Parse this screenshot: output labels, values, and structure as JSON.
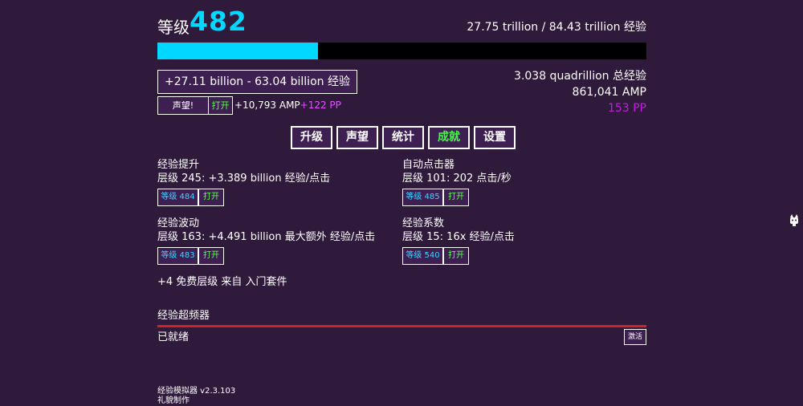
{
  "header": {
    "level_label": "等级",
    "level_value": "482",
    "xp_progress": "27.75 trillion / 84.43 trillion 经验",
    "xp_fraction": 0.3287
  },
  "click_range": "+27.11 billion - 63.04 billion 经验",
  "prestige": {
    "button_label": "声望!",
    "open_label": "打开",
    "amp_gain": "+10,793 AMP",
    "pp_gain": "+122 PP"
  },
  "stats": {
    "total_xp": "3.038 quadrillion 总经验",
    "amp": "861,041 AMP",
    "pp": "153 PP"
  },
  "tabs": [
    {
      "label": "升级"
    },
    {
      "label": "声望"
    },
    {
      "label": "统计"
    },
    {
      "label": "成就"
    },
    {
      "label": "设置"
    }
  ],
  "upgrades": [
    {
      "title": "经验提升",
      "desc": "层级 245: +3.389 billion 经验/点击",
      "level_button": "等级 484",
      "open_button": "打开"
    },
    {
      "title": "自动点击器",
      "desc": "层级 101: 202 点击/秒",
      "level_button": "等级 485",
      "open_button": "打开"
    },
    {
      "title": "经验波动",
      "desc": "层级 163: +4.491 billion 最大额外 经验/点击",
      "level_button": "等级 483",
      "open_button": "打开"
    },
    {
      "title": "经验系数",
      "desc": "层级 15: 16x 经验/点击",
      "level_button": "等级 540",
      "open_button": "打开"
    }
  ],
  "free_levels": "+4 免费层级 来自 入门套件",
  "overclock": {
    "title": "经验超频器",
    "status": "已就绪",
    "activate_label": "激活"
  },
  "footer": {
    "version": "经验模拟器 v2.3.103",
    "credit": "礼貌制作"
  },
  "colors": {
    "background": "#2f1a3c",
    "accent_cyan": "#00d8ff",
    "active_green": "#3dff3d",
    "pp_magenta": "#c21ce0",
    "overclock_red": "#d02424"
  },
  "icons": {
    "side_icon": "cat-icon"
  }
}
